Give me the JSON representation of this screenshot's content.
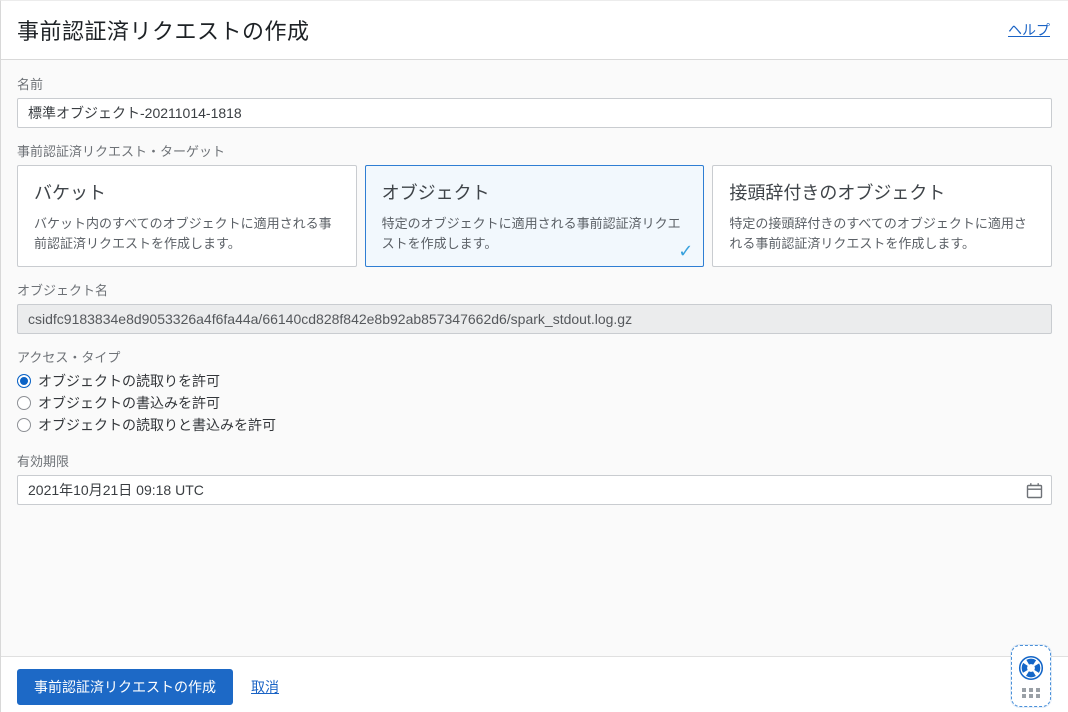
{
  "header": {
    "title": "事前認証済リクエストの作成",
    "help_label": "ヘルプ"
  },
  "form": {
    "name": {
      "label": "名前",
      "value": "標準オブジェクト-20211014-1818"
    },
    "target": {
      "label": "事前認証済リクエスト・ターゲット",
      "options": [
        {
          "title": "バケット",
          "description": "バケット内のすべてのオブジェクトに適用される事前認証済リクエストを作成します。",
          "selected": false
        },
        {
          "title": "オブジェクト",
          "description": "特定のオブジェクトに適用される事前認証済リクエストを作成します。",
          "selected": true,
          "check_glyph": "✓"
        },
        {
          "title": "接頭辞付きのオブジェクト",
          "description": "特定の接頭辞付きのすべてのオブジェクトに適用される事前認証済リクエストを作成します。",
          "selected": false
        }
      ]
    },
    "object_name": {
      "label": "オブジェクト名",
      "value": "csidfc9183834e8d9053326a4f6fa44a/66140cd828f842e8b92ab857347662d6/spark_stdout.log.gz",
      "disabled": true
    },
    "access_type": {
      "label": "アクセス・タイプ",
      "options": [
        {
          "label": "オブジェクトの読取りを許可",
          "selected": true
        },
        {
          "label": "オブジェクトの書込みを許可",
          "selected": false
        },
        {
          "label": "オブジェクトの読取りと書込みを許可",
          "selected": false
        }
      ]
    },
    "expiration": {
      "label": "有効期限",
      "value": "2021年10月21日 09:18 UTC",
      "icon": "calendar-icon"
    }
  },
  "footer": {
    "submit_label": "事前認証済リクエストの作成",
    "cancel_label": "取消"
  },
  "colors": {
    "primary_button": "#1d69c6",
    "link": "#1a63c5",
    "selected_card_border": "#2f7ed3",
    "selected_card_bg": "#f2f8fd",
    "checkmark": "#38a1dd",
    "radio_selected": "#0b63c6"
  }
}
